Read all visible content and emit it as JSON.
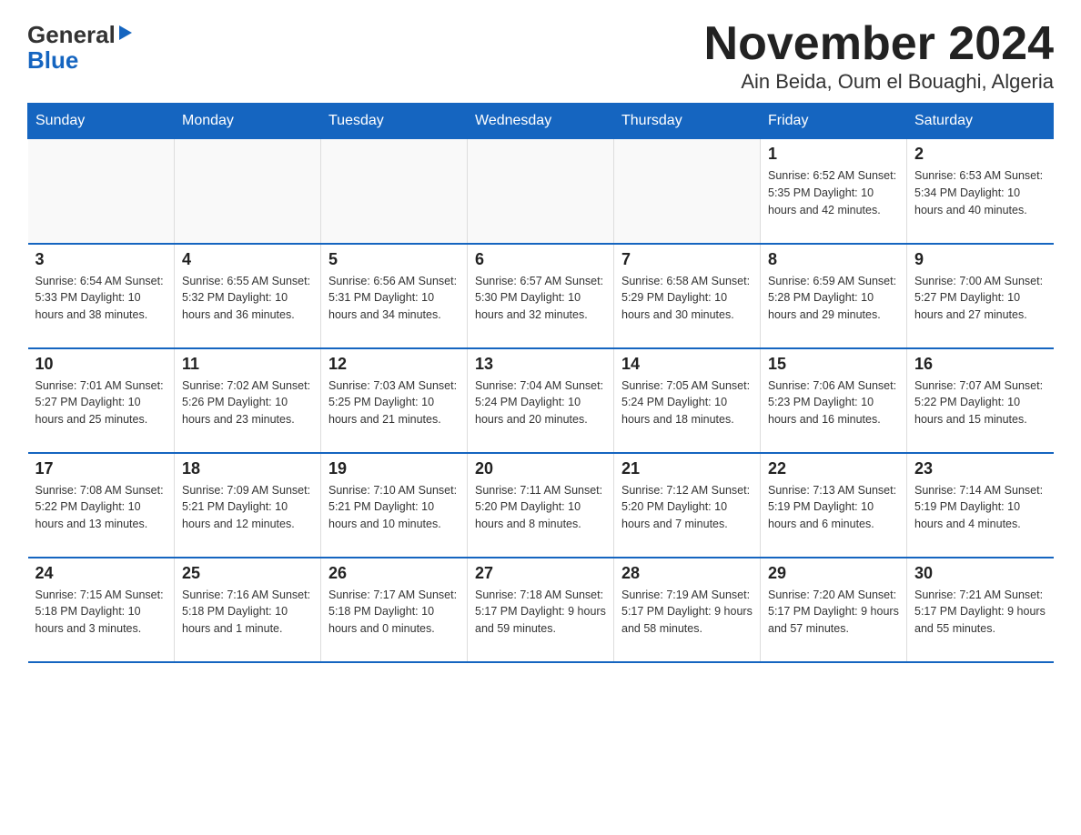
{
  "logo": {
    "general": "General",
    "blue": "Blue"
  },
  "title": "November 2024",
  "subtitle": "Ain Beida, Oum el Bouaghi, Algeria",
  "weekdays": [
    "Sunday",
    "Monday",
    "Tuesday",
    "Wednesday",
    "Thursday",
    "Friday",
    "Saturday"
  ],
  "weeks": [
    [
      {
        "day": "",
        "info": ""
      },
      {
        "day": "",
        "info": ""
      },
      {
        "day": "",
        "info": ""
      },
      {
        "day": "",
        "info": ""
      },
      {
        "day": "",
        "info": ""
      },
      {
        "day": "1",
        "info": "Sunrise: 6:52 AM\nSunset: 5:35 PM\nDaylight: 10 hours\nand 42 minutes."
      },
      {
        "day": "2",
        "info": "Sunrise: 6:53 AM\nSunset: 5:34 PM\nDaylight: 10 hours\nand 40 minutes."
      }
    ],
    [
      {
        "day": "3",
        "info": "Sunrise: 6:54 AM\nSunset: 5:33 PM\nDaylight: 10 hours\nand 38 minutes."
      },
      {
        "day": "4",
        "info": "Sunrise: 6:55 AM\nSunset: 5:32 PM\nDaylight: 10 hours\nand 36 minutes."
      },
      {
        "day": "5",
        "info": "Sunrise: 6:56 AM\nSunset: 5:31 PM\nDaylight: 10 hours\nand 34 minutes."
      },
      {
        "day": "6",
        "info": "Sunrise: 6:57 AM\nSunset: 5:30 PM\nDaylight: 10 hours\nand 32 minutes."
      },
      {
        "day": "7",
        "info": "Sunrise: 6:58 AM\nSunset: 5:29 PM\nDaylight: 10 hours\nand 30 minutes."
      },
      {
        "day": "8",
        "info": "Sunrise: 6:59 AM\nSunset: 5:28 PM\nDaylight: 10 hours\nand 29 minutes."
      },
      {
        "day": "9",
        "info": "Sunrise: 7:00 AM\nSunset: 5:27 PM\nDaylight: 10 hours\nand 27 minutes."
      }
    ],
    [
      {
        "day": "10",
        "info": "Sunrise: 7:01 AM\nSunset: 5:27 PM\nDaylight: 10 hours\nand 25 minutes."
      },
      {
        "day": "11",
        "info": "Sunrise: 7:02 AM\nSunset: 5:26 PM\nDaylight: 10 hours\nand 23 minutes."
      },
      {
        "day": "12",
        "info": "Sunrise: 7:03 AM\nSunset: 5:25 PM\nDaylight: 10 hours\nand 21 minutes."
      },
      {
        "day": "13",
        "info": "Sunrise: 7:04 AM\nSunset: 5:24 PM\nDaylight: 10 hours\nand 20 minutes."
      },
      {
        "day": "14",
        "info": "Sunrise: 7:05 AM\nSunset: 5:24 PM\nDaylight: 10 hours\nand 18 minutes."
      },
      {
        "day": "15",
        "info": "Sunrise: 7:06 AM\nSunset: 5:23 PM\nDaylight: 10 hours\nand 16 minutes."
      },
      {
        "day": "16",
        "info": "Sunrise: 7:07 AM\nSunset: 5:22 PM\nDaylight: 10 hours\nand 15 minutes."
      }
    ],
    [
      {
        "day": "17",
        "info": "Sunrise: 7:08 AM\nSunset: 5:22 PM\nDaylight: 10 hours\nand 13 minutes."
      },
      {
        "day": "18",
        "info": "Sunrise: 7:09 AM\nSunset: 5:21 PM\nDaylight: 10 hours\nand 12 minutes."
      },
      {
        "day": "19",
        "info": "Sunrise: 7:10 AM\nSunset: 5:21 PM\nDaylight: 10 hours\nand 10 minutes."
      },
      {
        "day": "20",
        "info": "Sunrise: 7:11 AM\nSunset: 5:20 PM\nDaylight: 10 hours\nand 8 minutes."
      },
      {
        "day": "21",
        "info": "Sunrise: 7:12 AM\nSunset: 5:20 PM\nDaylight: 10 hours\nand 7 minutes."
      },
      {
        "day": "22",
        "info": "Sunrise: 7:13 AM\nSunset: 5:19 PM\nDaylight: 10 hours\nand 6 minutes."
      },
      {
        "day": "23",
        "info": "Sunrise: 7:14 AM\nSunset: 5:19 PM\nDaylight: 10 hours\nand 4 minutes."
      }
    ],
    [
      {
        "day": "24",
        "info": "Sunrise: 7:15 AM\nSunset: 5:18 PM\nDaylight: 10 hours\nand 3 minutes."
      },
      {
        "day": "25",
        "info": "Sunrise: 7:16 AM\nSunset: 5:18 PM\nDaylight: 10 hours\nand 1 minute."
      },
      {
        "day": "26",
        "info": "Sunrise: 7:17 AM\nSunset: 5:18 PM\nDaylight: 10 hours\nand 0 minutes."
      },
      {
        "day": "27",
        "info": "Sunrise: 7:18 AM\nSunset: 5:17 PM\nDaylight: 9 hours\nand 59 minutes."
      },
      {
        "day": "28",
        "info": "Sunrise: 7:19 AM\nSunset: 5:17 PM\nDaylight: 9 hours\nand 58 minutes."
      },
      {
        "day": "29",
        "info": "Sunrise: 7:20 AM\nSunset: 5:17 PM\nDaylight: 9 hours\nand 57 minutes."
      },
      {
        "day": "30",
        "info": "Sunrise: 7:21 AM\nSunset: 5:17 PM\nDaylight: 9 hours\nand 55 minutes."
      }
    ]
  ]
}
